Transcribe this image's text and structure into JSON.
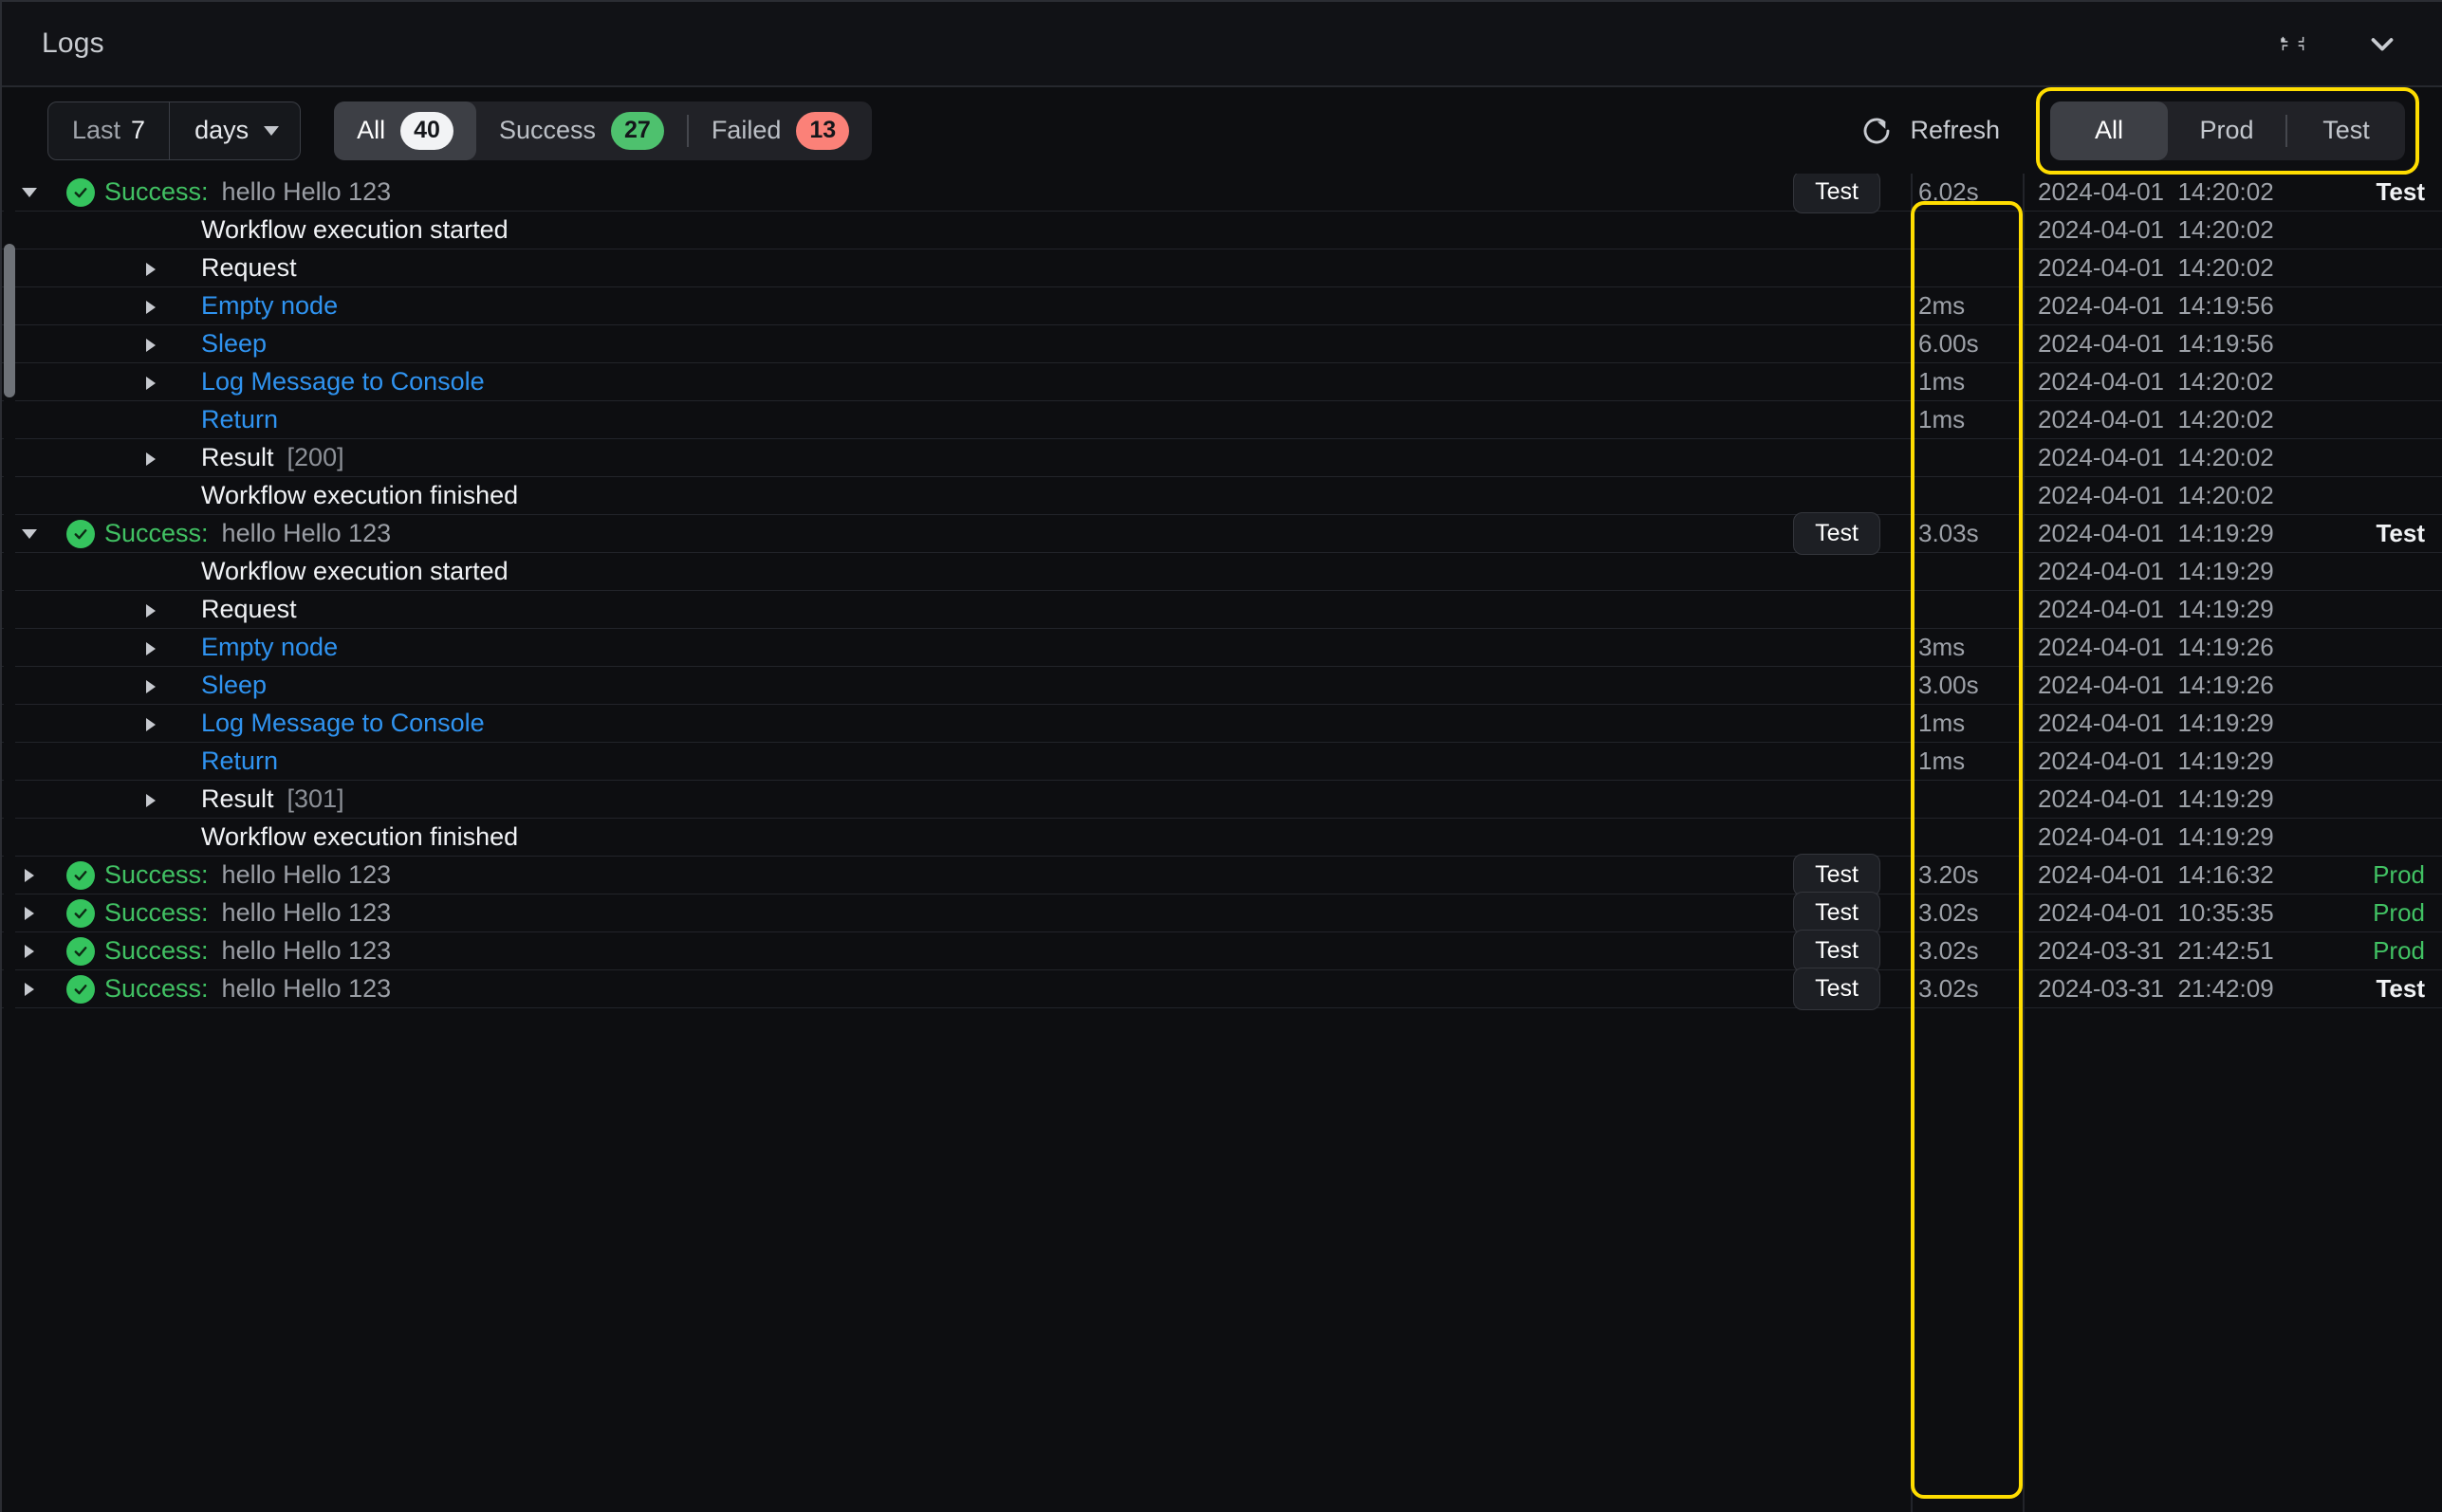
{
  "window": {
    "title": "Logs",
    "minimize_icon": "compress-icon",
    "collapse_icon": "chevron-down-icon"
  },
  "toolbar": {
    "range": {
      "label": "Last",
      "value": "7",
      "unit": "days",
      "chevron_icon": "chevron-down-icon"
    },
    "status_filter": {
      "options": [
        {
          "label": "All",
          "count": "40",
          "active": true,
          "badge_color": "#f2f3f5"
        },
        {
          "label": "Success",
          "count": "27",
          "active": false,
          "badge_color": "#4ec16e"
        },
        {
          "label": "Failed",
          "count": "13",
          "active": false,
          "badge_color": "#fb8178"
        }
      ]
    },
    "refresh": {
      "label": "Refresh",
      "icon": "refresh-icon"
    },
    "env_filter": {
      "highlight_color": "#ffdd00",
      "options": [
        {
          "label": "All",
          "active": true
        },
        {
          "label": "Prod",
          "active": false
        },
        {
          "label": "Test",
          "active": false
        }
      ]
    }
  },
  "duration_column_highlight_color": "#ffdd00",
  "colors": {
    "success_green": "#41c163",
    "node_blue": "#2f93f0",
    "highlight_yellow": "#ffdd00",
    "failed_red": "#fb8178"
  },
  "log_rows": [
    {
      "kind": "parent",
      "expanded": true,
      "status": "Success:",
      "message": "hello Hello 123",
      "test_button": "Test",
      "duration": "6.02s",
      "date": "2024-04-01",
      "time": "14:20:02",
      "env": "Test",
      "env_style": "test"
    },
    {
      "kind": "child-plain",
      "caret": "none",
      "text": "Workflow execution started",
      "duration": "",
      "date": "2024-04-01",
      "time": "14:20:02"
    },
    {
      "kind": "child-plain",
      "caret": "right",
      "text": "Request",
      "duration": "",
      "date": "2024-04-01",
      "time": "14:20:02"
    },
    {
      "kind": "child-node",
      "caret": "right",
      "text": "Empty node",
      "duration": "2ms",
      "date": "2024-04-01",
      "time": "14:19:56"
    },
    {
      "kind": "child-node",
      "caret": "right",
      "text": "Sleep",
      "duration": "6.00s",
      "date": "2024-04-01",
      "time": "14:19:56"
    },
    {
      "kind": "child-node",
      "caret": "right",
      "text": "Log Message to Console",
      "duration": "1ms",
      "date": "2024-04-01",
      "time": "14:20:02"
    },
    {
      "kind": "child-node",
      "caret": "none",
      "text": "Return",
      "duration": "1ms",
      "date": "2024-04-01",
      "time": "14:20:02"
    },
    {
      "kind": "child-result",
      "caret": "right",
      "text": "Result",
      "code": "[200]",
      "duration": "",
      "date": "2024-04-01",
      "time": "14:20:02"
    },
    {
      "kind": "child-plain",
      "caret": "none",
      "text": "Workflow execution finished",
      "duration": "",
      "date": "2024-04-01",
      "time": "14:20:02"
    },
    {
      "kind": "parent",
      "expanded": true,
      "status": "Success:",
      "message": "hello Hello 123",
      "test_button": "Test",
      "duration": "3.03s",
      "date": "2024-04-01",
      "time": "14:19:29",
      "env": "Test",
      "env_style": "test"
    },
    {
      "kind": "child-plain",
      "caret": "none",
      "text": "Workflow execution started",
      "duration": "",
      "date": "2024-04-01",
      "time": "14:19:29"
    },
    {
      "kind": "child-plain",
      "caret": "right",
      "text": "Request",
      "duration": "",
      "date": "2024-04-01",
      "time": "14:19:29"
    },
    {
      "kind": "child-node",
      "caret": "right",
      "text": "Empty node",
      "duration": "3ms",
      "date": "2024-04-01",
      "time": "14:19:26"
    },
    {
      "kind": "child-node",
      "caret": "right",
      "text": "Sleep",
      "duration": "3.00s",
      "date": "2024-04-01",
      "time": "14:19:26"
    },
    {
      "kind": "child-node",
      "caret": "right",
      "text": "Log Message to Console",
      "duration": "1ms",
      "date": "2024-04-01",
      "time": "14:19:29"
    },
    {
      "kind": "child-node",
      "caret": "none",
      "text": "Return",
      "duration": "1ms",
      "date": "2024-04-01",
      "time": "14:19:29"
    },
    {
      "kind": "child-result",
      "caret": "right",
      "text": "Result",
      "code": "[301]",
      "duration": "",
      "date": "2024-04-01",
      "time": "14:19:29"
    },
    {
      "kind": "child-plain",
      "caret": "none",
      "text": "Workflow execution finished",
      "duration": "",
      "date": "2024-04-01",
      "time": "14:19:29"
    },
    {
      "kind": "parent",
      "expanded": false,
      "status": "Success:",
      "message": "hello Hello 123",
      "test_button": "Test",
      "duration": "3.20s",
      "date": "2024-04-01",
      "time": "14:16:32",
      "env": "Prod",
      "env_style": "prod"
    },
    {
      "kind": "parent",
      "expanded": false,
      "status": "Success:",
      "message": "hello Hello 123",
      "test_button": "Test",
      "duration": "3.02s",
      "date": "2024-04-01",
      "time": "10:35:35",
      "env": "Prod",
      "env_style": "prod"
    },
    {
      "kind": "parent",
      "expanded": false,
      "status": "Success:",
      "message": "hello Hello 123",
      "test_button": "Test",
      "duration": "3.02s",
      "date": "2024-03-31",
      "time": "21:42:51",
      "env": "Prod",
      "env_style": "prod"
    },
    {
      "kind": "parent",
      "expanded": false,
      "status": "Success:",
      "message": "hello Hello 123",
      "test_button": "Test",
      "duration": "3.02s",
      "date": "2024-03-31",
      "time": "21:42:09",
      "env": "Test",
      "env_style": "test"
    }
  ]
}
